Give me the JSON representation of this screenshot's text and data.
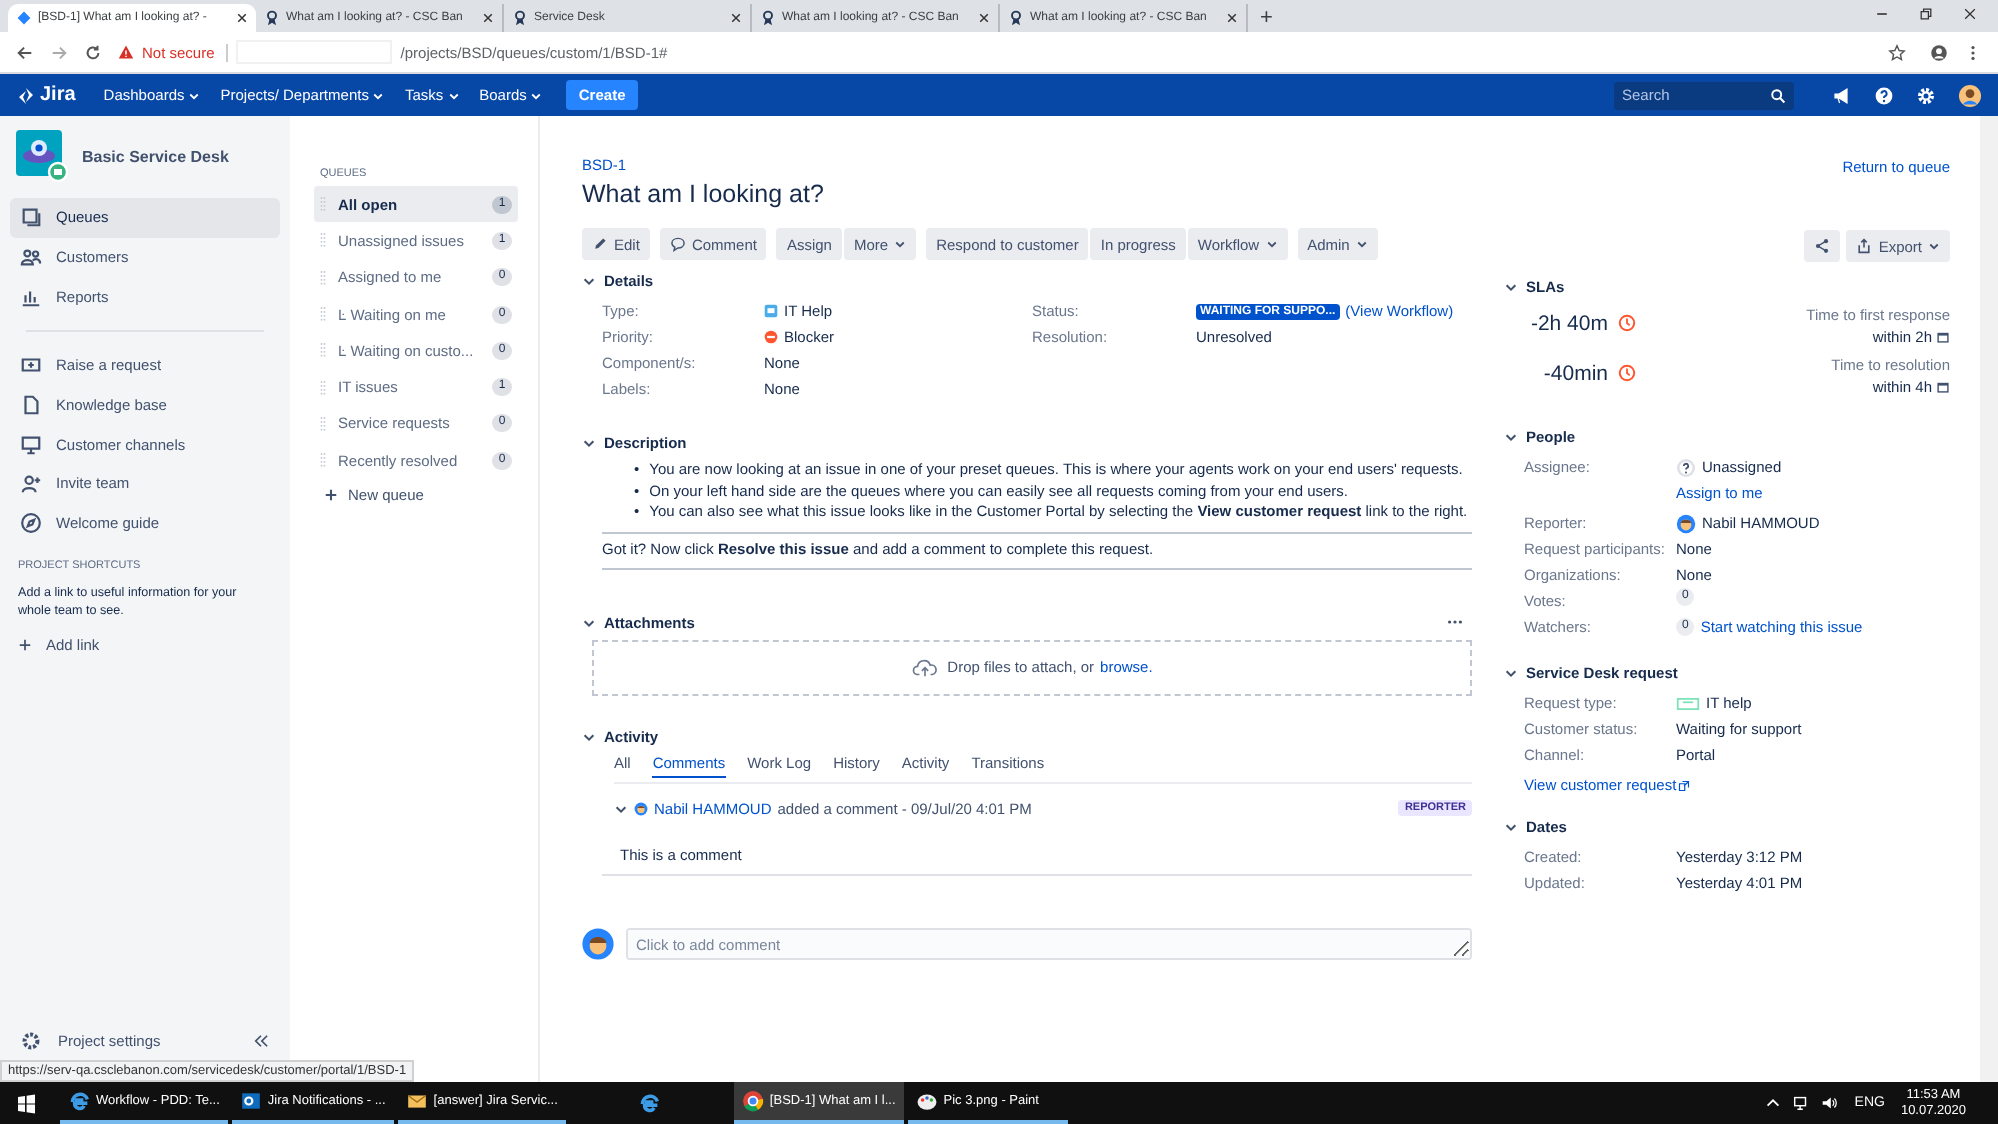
{
  "browser": {
    "tabs": [
      {
        "title": "[BSD-1] What am I looking at? - ",
        "selected": true
      },
      {
        "title": "What am I looking at? - CSC Ban",
        "selected": false
      },
      {
        "title": "Service Desk",
        "selected": false
      },
      {
        "title": "What am I looking at? - CSC Ban",
        "selected": false
      },
      {
        "title": "What am I looking at? - CSC Ban",
        "selected": false
      }
    ],
    "new_tab": "+",
    "security": "Not secure",
    "url": "/projects/BSD/queues/custom/1/BSD-1#",
    "status_url": "https://serv-qa.csclebanon.com/servicedesk/customer/portal/1/BSD-1"
  },
  "nav": {
    "logo": "Jira",
    "menus": [
      "Dashboards",
      "Projects/ Departments",
      "Tasks",
      "Boards"
    ],
    "create": "Create",
    "search": {
      "placeholder": "Search"
    }
  },
  "project": {
    "name": "Basic Service Desk",
    "items": [
      {
        "label": "Queues",
        "selected": true
      },
      {
        "label": "Customers",
        "selected": false
      },
      {
        "label": "Reports",
        "selected": false
      }
    ],
    "links": [
      "Raise a request",
      "Knowledge base",
      "Customer channels",
      "Invite team",
      "Welcome guide"
    ],
    "shortcuts": {
      "heading": "PROJECT SHORTCUTS",
      "text": "Add a link to useful information for your whole team to see.",
      "add": "Add link"
    },
    "settings": "Project settings"
  },
  "queues": {
    "heading": "QUEUES",
    "items": [
      {
        "label": "All open",
        "count": "1",
        "selected": true
      },
      {
        "label": "Unassigned issues",
        "count": "1",
        "selected": false
      },
      {
        "label": "Assigned to me",
        "count": "0",
        "selected": false
      },
      {
        "label": "Ŀ Waiting on me",
        "count": "0",
        "selected": false
      },
      {
        "label": "Ŀ Waiting on custo...",
        "count": "0",
        "selected": false
      },
      {
        "label": "IT issues",
        "count": "1",
        "selected": false
      },
      {
        "label": "Service requests",
        "count": "0",
        "selected": false
      },
      {
        "label": "Recently resolved",
        "count": "0",
        "selected": false
      }
    ],
    "new": "New queue"
  },
  "issue": {
    "key": "BSD-1",
    "title": "What am I looking at?",
    "return": "Return to queue",
    "toolbar": [
      [
        {
          "label": "Edit",
          "kind": "edit"
        }
      ],
      [
        {
          "label": "Comment",
          "kind": "comment"
        }
      ],
      [
        {
          "label": "Assign",
          "kind": "plain"
        },
        {
          "label": "More",
          "kind": "menu"
        }
      ],
      [
        {
          "label": "Respond to customer",
          "kind": "plain"
        },
        {
          "label": "In progress",
          "kind": "plain"
        },
        {
          "label": "Workflow",
          "kind": "menu"
        }
      ],
      [
        {
          "label": "Admin",
          "kind": "menu"
        }
      ]
    ],
    "export": "Export",
    "details": {
      "heading": "Details",
      "left": [
        {
          "label": "Type:",
          "value": "IT Help",
          "kind": "type"
        },
        {
          "label": "Priority:",
          "value": "Blocker",
          "kind": "priority"
        },
        {
          "label": "Component/s:",
          "value": "None",
          "kind": "text"
        },
        {
          "label": "Labels:",
          "value": "None",
          "kind": "text"
        }
      ],
      "right": [
        {
          "label": "Status:",
          "value": "WAITING FOR SUPPO...",
          "link": "(View Workflow)",
          "kind": "status"
        },
        {
          "label": "Resolution:",
          "value": "Unresolved",
          "kind": "text"
        }
      ]
    },
    "description": {
      "heading": "Description",
      "marker": "•",
      "bullets": [
        "You are now looking at an issue in one of your preset queues. This is where your agents work on your end users' requests.",
        "On your left hand side are the queues where you can easily see all requests coming from your end users.",
        "You can also see what this issue looks like in the Customer Portal by selecting the **View customer request** link to the right."
      ],
      "note": "Got it? Now click **Resolve this issue** and add a comment to complete this request."
    },
    "attachments": {
      "heading": "Attachments",
      "drop": "Drop files to attach, or",
      "browse": "browse."
    },
    "activity": {
      "heading": "Activity",
      "tabs": [
        {
          "label": "All",
          "selected": false
        },
        {
          "label": "Comments",
          "selected": true
        },
        {
          "label": "Work Log",
          "selected": false
        },
        {
          "label": "History",
          "selected": false
        },
        {
          "label": "Activity",
          "selected": false
        },
        {
          "label": "Transitions",
          "selected": false
        }
      ],
      "comment": {
        "author": "Nabil HAMMOUD",
        "action": "added a comment - 09/Jul/20 4:01 PM",
        "badge": "REPORTER",
        "body": "This is a comment"
      },
      "add_comment": {
        "placeholder": "Click to add comment"
      }
    },
    "slas": {
      "heading": "SLAs",
      "items": [
        {
          "time": "-2h 40m",
          "goal": "Time to first response",
          "within": "within 2h"
        },
        {
          "time": "-40min",
          "goal": "Time to resolution",
          "within": "within 4h"
        }
      ]
    },
    "people": {
      "heading": "People",
      "rows": [
        {
          "label": "Assignee:",
          "value": "Unassigned",
          "kind": "unassigned",
          "link": "Assign to me"
        },
        {
          "label": "Reporter:",
          "value": "Nabil HAMMOUD",
          "kind": "user"
        },
        {
          "label": "Request participants:",
          "value": "None",
          "kind": "text"
        },
        {
          "label": "Organizations:",
          "value": "None",
          "kind": "text"
        },
        {
          "label": "Votes:",
          "value": "0",
          "kind": "count"
        },
        {
          "label": "Watchers:",
          "value": "0",
          "kind": "count",
          "link": "Start watching this issue"
        }
      ]
    },
    "request": {
      "heading": "Service Desk request",
      "rows": [
        {
          "label": "Request type:",
          "value": "IT help",
          "kind": "request"
        },
        {
          "label": "Customer status:",
          "value": "Waiting for support",
          "kind": "text"
        },
        {
          "label": "Channel:",
          "value": "Portal",
          "kind": "text"
        }
      ],
      "link": "View customer request"
    },
    "dates": {
      "heading": "Dates",
      "rows": [
        {
          "label": "Created:",
          "value": "Yesterday 3:12 PM",
          "kind": "text"
        },
        {
          "label": "Updated:",
          "value": "Yesterday 4:01 PM",
          "kind": "text"
        }
      ]
    }
  },
  "taskbar": {
    "items": [
      {
        "label": "Workflow - PDD: Te...",
        "kind": "edge",
        "selected": false
      },
      {
        "label": "Jira Notifications - ...",
        "kind": "outlook",
        "selected": false
      },
      {
        "label": "[answer] Jira Servic...",
        "kind": "mail",
        "selected": false
      },
      {
        "kind": "ie",
        "selected": false
      },
      {
        "label": "[BSD-1] What am I l...",
        "kind": "chrome",
        "selected": true
      },
      {
        "label": "Pic 3.png - Paint",
        "kind": "paint",
        "selected": false
      }
    ],
    "language": "ENG",
    "time": "11:53 AM",
    "date": "10.07.2020"
  }
}
